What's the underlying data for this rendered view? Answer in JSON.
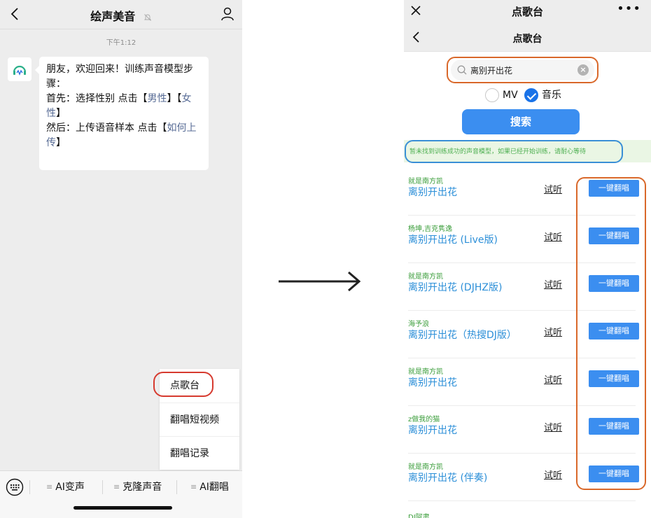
{
  "left": {
    "title": "绘声美音",
    "time": "下午1:12",
    "message": {
      "line1": "朋友，欢迎回来！训练声音模型步骤：",
      "line2_prefix": "首先：选择性别 点击【",
      "line2_link1": "男性",
      "line2_mid": "】【",
      "line2_link2": "女性",
      "line2_suffix": "】",
      "line3_prefix": "然后：上传语音样本 点击【",
      "line3_link": "如何上传",
      "line3_suffix": "】"
    },
    "menu": [
      "点歌台",
      "翻唱短视频",
      "翻唱记录"
    ],
    "tabs": [
      "AI变声",
      "克隆声音",
      "AI翻唱"
    ]
  },
  "right": {
    "top_title": "点歌台",
    "more": "•••",
    "nav_title": "点歌台",
    "search_value": "离别开出花",
    "option_mv": "MV",
    "option_music": "音乐",
    "search_button": "搜索",
    "notice": "暂未找到训练成功的声音模型，如果已经开始训练，请耐心等待",
    "listen_label": "试听",
    "cover_label": "一键翻唱",
    "results": [
      {
        "artist": "就是南方凯",
        "song": "离别开出花"
      },
      {
        "artist": "杨坤,吉克隽逸",
        "song": "离别开出花 (Live版)"
      },
      {
        "artist": "就是南方凯",
        "song": "离别开出花 (DJHZ版)"
      },
      {
        "artist": "海予浪",
        "song": "离别开出花（热搜DJ版）"
      },
      {
        "artist": "就是南方凯",
        "song": "离别开出花"
      },
      {
        "artist": "z做我的猫",
        "song": "离别开出花"
      },
      {
        "artist": "就是南方凯",
        "song": "离别开出花 (伴奏)"
      }
    ],
    "partial_artist": "DJ阿肃"
  },
  "colors": {
    "accent_blue": "#3b8ef0",
    "song_blue": "#2c8fd8",
    "artist_green": "#3a9d3a",
    "highlight_orange": "#d9682a",
    "highlight_red": "#d63a2f",
    "highlight_blue": "#3a8fd6"
  }
}
